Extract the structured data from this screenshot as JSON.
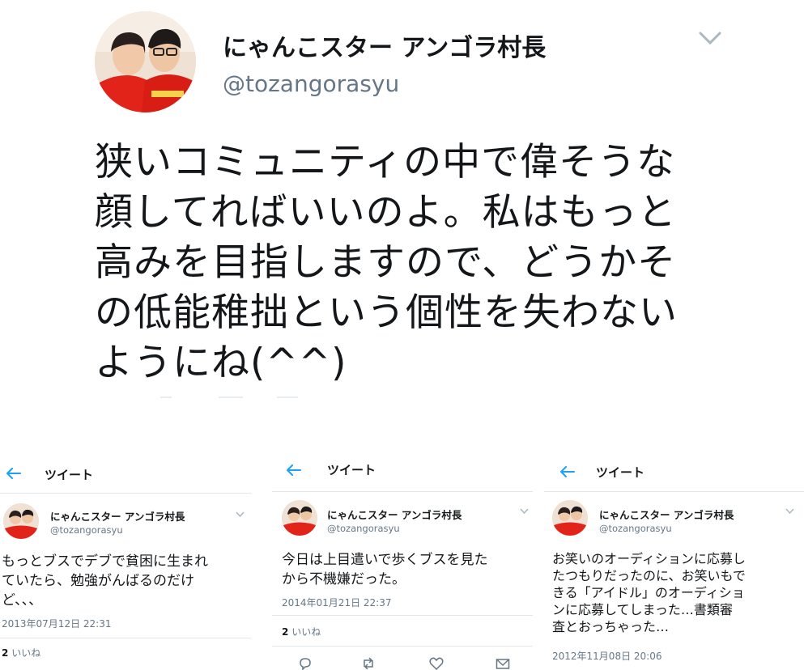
{
  "main_tweet": {
    "author_name": "にゃんこスター アンゴラ村長",
    "handle": "@tozangorasyu",
    "text_lines": [
      "狭いコミュニティの中で偉そうな",
      "顔してればいいのよ。私はもっと",
      "高みを目指しますので、どうかそ",
      "の低能稚拙という個性を失わない",
      "ようにね(^^)"
    ],
    "icons": {
      "avatar": "avatar",
      "menu": "chevron-down-icon"
    }
  },
  "cards": [
    {
      "header_title": "ツイート",
      "author_name": "にゃんこスター アンゴラ村長",
      "handle": "@tozangorasyu",
      "text_lines": [
        "もっとブスでデブで貧困に生まれ",
        "ていたら、勉強がんばるのだけ",
        "ど、、、"
      ],
      "date": "2013年07月12日 22:31",
      "likes_count": "2",
      "likes_label": "いいね"
    },
    {
      "header_title": "ツイート",
      "author_name": "にゃんこスター アンゴラ村長",
      "handle": "@tozangorasyu",
      "text_lines": [
        "今日は上目遣いで歩くブスを見た",
        "から不機嫌だった。"
      ],
      "date": "2014年01月21日 22:37",
      "likes_count": "2",
      "likes_label": "いいね",
      "actions": [
        "reply-icon",
        "retweet-icon",
        "like-icon",
        "dm-icon"
      ]
    },
    {
      "header_title": "ツイート",
      "author_name": "にゃんこスター アンゴラ村長",
      "handle": "@tozangorasyu",
      "text_lines": [
        "お笑いのオーディションに応募し",
        "たつもりだったのに、お笑いもで",
        "きる「アイドル」のオーディショ",
        "ンに応募してしまった…書類審",
        "査とおっちゃった…"
      ],
      "date": "2012年11月08日 20:06"
    }
  ],
  "colors": {
    "accent": "#1da1f2",
    "text": "#14171a",
    "secondary": "#657786",
    "border": "#e1e8ed",
    "avatar_shirt": "#e2231a"
  }
}
